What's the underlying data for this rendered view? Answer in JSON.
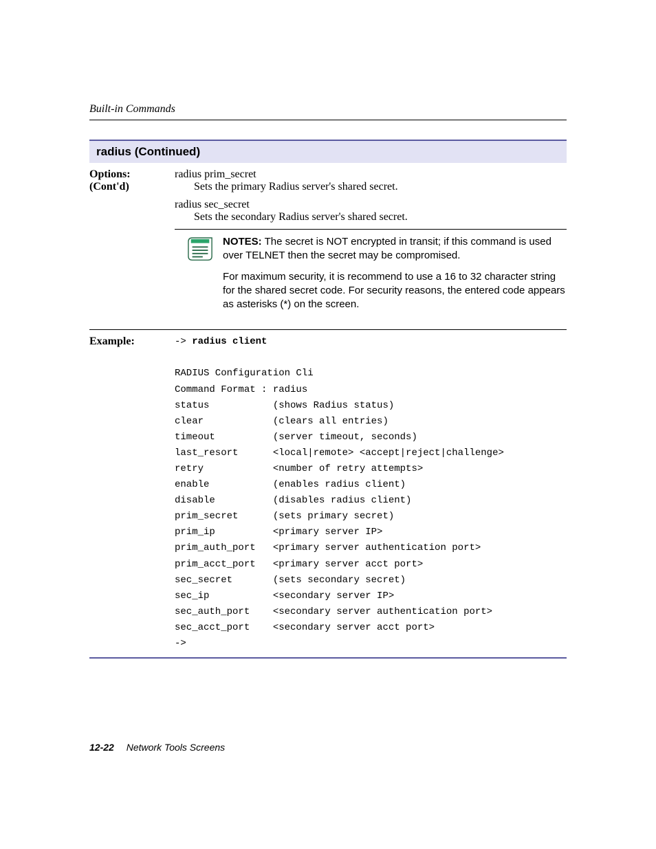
{
  "running_head": "Built-in Commands",
  "section_title": "radius (Continued)",
  "options_label_line1": "Options:",
  "options_label_line2": "(Cont'd)",
  "options": [
    {
      "name": "radius prim_secret",
      "desc": "Sets the primary Radius server's shared secret."
    },
    {
      "name": "radius sec_secret",
      "desc": "Sets the secondary Radius server's shared secret."
    }
  ],
  "notes_label": "NOTES:",
  "notes": [
    "The secret is NOT encrypted in transit; if this command is used over TELNET then the secret may be compromised.",
    "For maximum security, it is recommend to use a 16 to 32 character string for the shared secret code. For security reasons, the entered code appears as asterisks (*) on the screen."
  ],
  "example_label": "Example:",
  "example_prompt": "-> ",
  "example_cmd": "radius client",
  "example_lines": [
    "",
    "RADIUS Configuration Cli",
    "Command Format : radius",
    "status           (shows Radius status)",
    "clear            (clears all entries)",
    "timeout          (server timeout, seconds)",
    "last_resort      <local|remote> <accept|reject|challenge>",
    "retry            <number of retry attempts>",
    "enable           (enables radius client)",
    "disable          (disables radius client)",
    "prim_secret      (sets primary secret)",
    "prim_ip          <primary server IP>",
    "prim_auth_port   <primary server authentication port>",
    "prim_acct_port   <primary server acct port>",
    "sec_secret       (sets secondary secret)",
    "sec_ip           <secondary server IP>",
    "sec_auth_port    <secondary server authentication port>",
    "sec_acct_port    <secondary server acct port>",
    "->"
  ],
  "footer_page": "12-22",
  "footer_title": "Network Tools Screens"
}
